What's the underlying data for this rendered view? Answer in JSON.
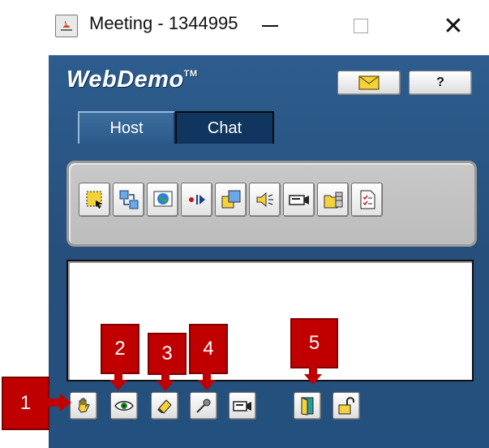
{
  "window": {
    "title": "Meeting - 1344995"
  },
  "app": {
    "logo_text": "WebDemo",
    "logo_mark": "TM",
    "help_label": "?",
    "tabs": [
      {
        "label": "Host"
      },
      {
        "label": "Chat"
      }
    ]
  },
  "toolbar": {
    "icons": [
      "select-region-icon",
      "share-apps-icon",
      "web-browser-icon",
      "record-icon",
      "windows-icon",
      "audio-icon",
      "video-camera-icon",
      "files-icon",
      "checklist-icon"
    ]
  },
  "controls": {
    "icons": [
      "raise-hand-icon",
      "eye-icon",
      "eraser-icon",
      "microphone-icon",
      "camera-icon",
      "exit-door-icon",
      "lock-icon"
    ]
  },
  "callouts": [
    "1",
    "2",
    "3",
    "4",
    "5"
  ],
  "colors": {
    "window_bg": "#2b5a8a",
    "callout": "#c00000",
    "toolbar": "#c4c4c4"
  }
}
